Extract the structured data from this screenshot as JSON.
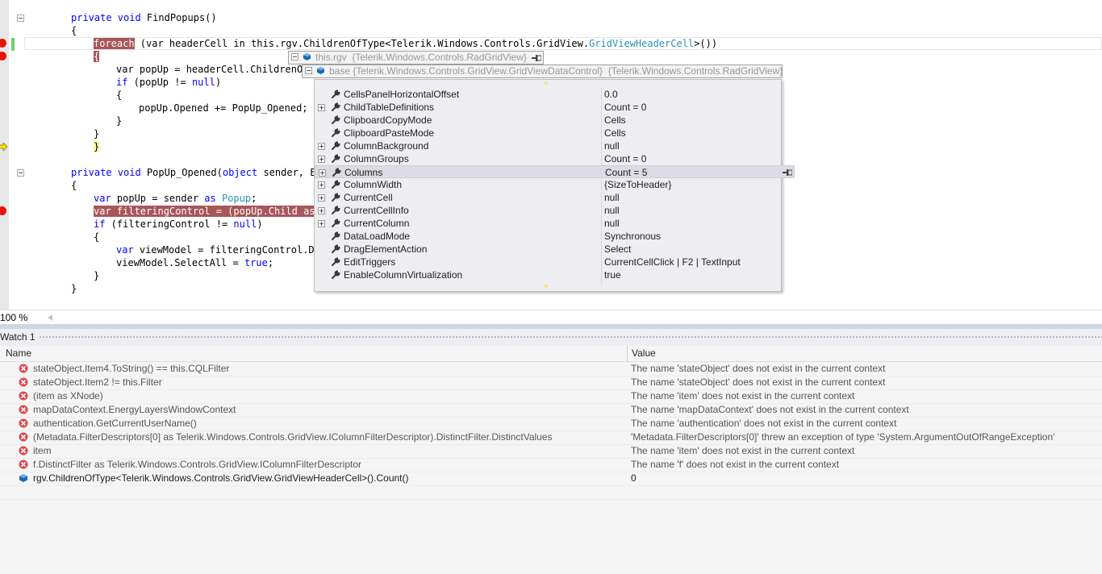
{
  "editor": {
    "lines": [
      {
        "k1": "private void",
        "t1": " FindPopups()"
      },
      {
        "t1": "{"
      },
      {
        "kw": "foreach",
        "rest": " (var headerCell in this.rgv.ChildrenOfType<Telerik.Windows.Controls.GridView.",
        "ty": "GridViewHeaderCell",
        "end": ">())"
      },
      {
        "t1": "{"
      },
      {
        "pre": "var popUp = headerCell.ChildrenOf"
      },
      {
        "k1": "if",
        "t1": " (popUp != ",
        "k2": "null",
        "t2": ")"
      },
      {
        "t1": "{"
      },
      {
        "t1": "popUp.Opened += PopUp_Opened;"
      },
      {
        "t1": "}"
      },
      {
        "t1": "}"
      },
      {
        "k1": "private void",
        "t1": " PopUp_Opened(",
        "k2": "object",
        "t2": " sender, Ev"
      },
      {
        "t1": "{"
      },
      {
        "k1": "var",
        "t1": " popUp = sender ",
        "k2": "as",
        "t2": " ",
        "ty": "Popup",
        "t3": ";"
      },
      {
        "hl": "var filteringControl = (popUp.Child as "
      },
      {
        "k1": "if",
        "t1": " (filteringControl != ",
        "k2": "null",
        "t2": ")"
      },
      {
        "t1": "{"
      },
      {
        "k1": "var",
        "t1": " viewModel = filteringControl.Da"
      },
      {
        "t1": "viewModel.SelectAll = ",
        "k2": "true",
        "t2": ";"
      },
      {
        "t1": "}"
      },
      {
        "t1": "}"
      }
    ]
  },
  "datatip": {
    "row1_name": "this.rgv",
    "row1_type": "{Telerik.Windows.Controls.RadGridView}",
    "row2_name": "base",
    "row2_type": "{Telerik.Windows.Controls.GridView.GridViewDataControl}",
    "row2_value": "{Telerik.Windows.Controls.RadGridView}",
    "properties": [
      {
        "name": "CellsPanelHorizontalOffset",
        "value": "0.0",
        "expandable": false
      },
      {
        "name": "ChildTableDefinitions",
        "value": "Count = 0",
        "expandable": true
      },
      {
        "name": "ClipboardCopyMode",
        "value": "Cells",
        "expandable": false
      },
      {
        "name": "ClipboardPasteMode",
        "value": "Cells",
        "expandable": false
      },
      {
        "name": "ColumnBackground",
        "value": "null",
        "expandable": true
      },
      {
        "name": "ColumnGroups",
        "value": "Count = 0",
        "expandable": true
      },
      {
        "name": "Columns",
        "value": "Count = 5",
        "expandable": true
      },
      {
        "name": "ColumnWidth",
        "value": "{SizeToHeader}",
        "expandable": true
      },
      {
        "name": "CurrentCell",
        "value": "null",
        "expandable": true
      },
      {
        "name": "CurrentCellInfo",
        "value": "null",
        "expandable": true
      },
      {
        "name": "CurrentColumn",
        "value": "null",
        "expandable": true
      },
      {
        "name": "DataLoadMode",
        "value": "Synchronous",
        "expandable": false
      },
      {
        "name": "DragElementAction",
        "value": "Select",
        "expandable": false
      },
      {
        "name": "EditTriggers",
        "value": "CurrentCellClick | F2 | TextInput",
        "expandable": false
      },
      {
        "name": "EnableColumnVirtualization",
        "value": "true",
        "expandable": false
      }
    ]
  },
  "zoom": "100 %",
  "watch": {
    "title": "Watch 1",
    "col_name": "Name",
    "col_value": "Value",
    "rows": [
      {
        "name": "stateObject.Item4.ToString() == this.CQLFilter",
        "value": "The name 'stateObject' does not exist in the current context",
        "error": true
      },
      {
        "name": "stateObject.Item2 != this.Filter",
        "value": "The name 'stateObject' does not exist in the current context",
        "error": true
      },
      {
        "name": "(item as XNode)",
        "value": "The name 'item' does not exist in the current context",
        "error": true
      },
      {
        "name": "mapDataContext.EnergyLayersWindowContext",
        "value": "The name 'mapDataContext' does not exist in the current context",
        "error": true
      },
      {
        "name": "authentication.GetCurrentUserName()",
        "value": "The name 'authentication' does not exist in the current context",
        "error": true
      },
      {
        "name": "(Metadata.FilterDescriptors[0] as Telerik.Windows.Controls.GridView.IColumnFilterDescriptor).DistinctFilter.DistinctValues",
        "value": "'Metadata.FilterDescriptors[0]' threw an exception of type 'System.ArgumentOutOfRangeException'",
        "error": true
      },
      {
        "name": "item",
        "value": "The name 'item' does not exist in the current context",
        "error": true
      },
      {
        "name": "f.DistinctFilter as Telerik.Windows.Controls.GridView.IColumnFilterDescriptor",
        "value": "The name 'f' does not exist in the current context",
        "error": true
      },
      {
        "name": "rgv.ChildrenOfType<Telerik.Windows.Controls.GridView.GridViewHeaderCell>().Count()",
        "value": "0",
        "error": false
      }
    ]
  },
  "colors": {
    "breakpoint": "#e51400",
    "highlight": "#a8565a",
    "keyword": "#0000ff",
    "type": "#2b91af"
  }
}
